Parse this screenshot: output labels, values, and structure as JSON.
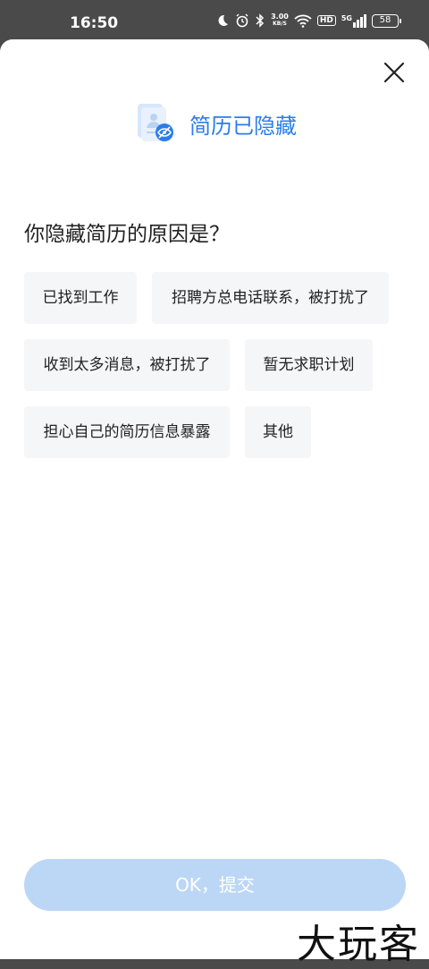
{
  "status_bar": {
    "time": "16:50",
    "net_speed_value": "3.00",
    "net_speed_unit": "KB/S",
    "hd_label": "HD",
    "signal_label": "5G",
    "battery": "58"
  },
  "header": {
    "title": "简历已隐藏"
  },
  "question": "你隐藏简历的原因是？",
  "reasons": [
    "已找到工作",
    "招聘方总电话联系，被打扰了",
    "收到太多消息，被打扰了",
    "暂无求职计划",
    "担心自己的简历信息暴露",
    "其他"
  ],
  "submit_label": "OK，提交",
  "watermark": "大玩客",
  "colors": {
    "accent": "#2b7de9",
    "submit_disabled": "#bcd6f6",
    "chip_bg": "#f5f6f8"
  }
}
